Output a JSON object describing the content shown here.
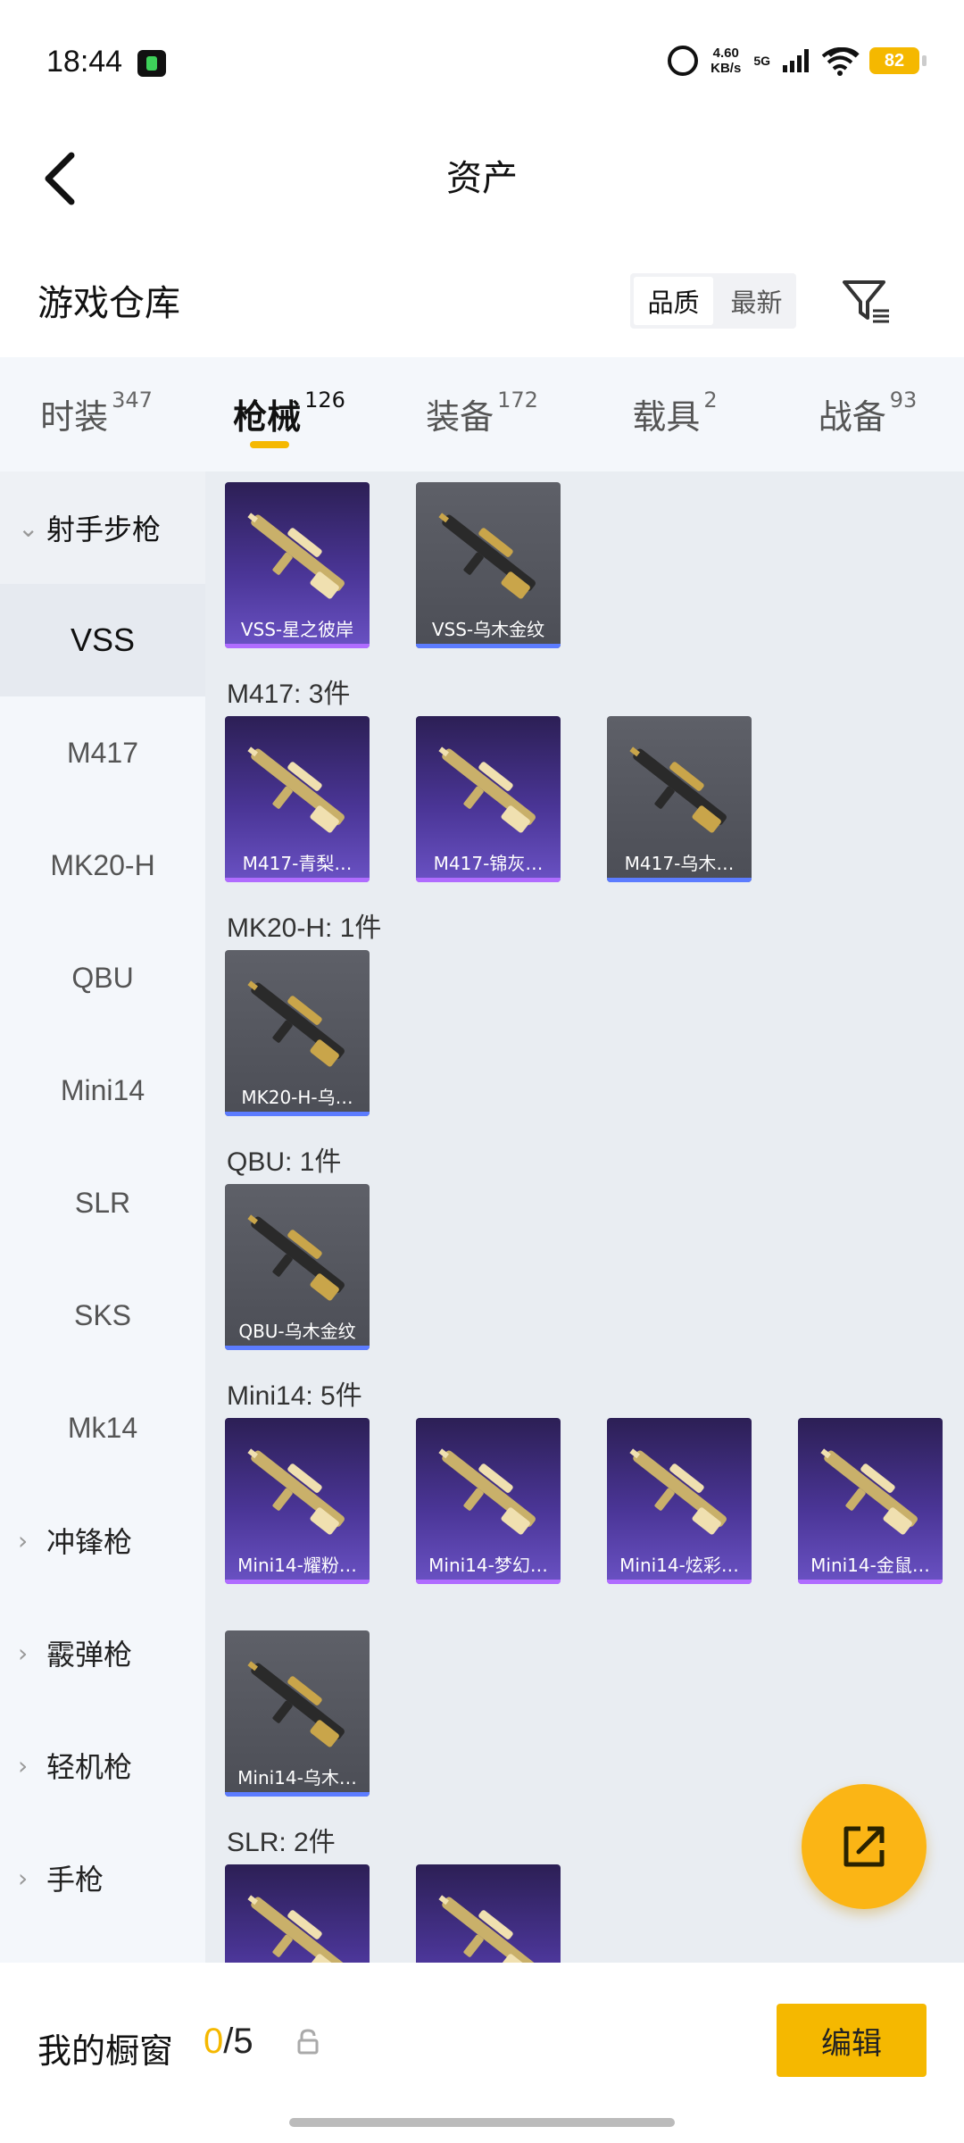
{
  "status_bar": {
    "time": "18:44",
    "net_speed_value": "4.60",
    "net_speed_unit": "KB/s",
    "network_type": "5G",
    "battery": "82"
  },
  "header": {
    "title": "资产"
  },
  "section": {
    "title": "游戏仓库",
    "sort_options": [
      "品质",
      "最新"
    ],
    "active_sort": "品质"
  },
  "tabs": [
    {
      "label": "时装",
      "count": "347"
    },
    {
      "label": "枪械",
      "count": "126",
      "active": true
    },
    {
      "label": "装备",
      "count": "172"
    },
    {
      "label": "载具",
      "count": "2"
    },
    {
      "label": "战备",
      "count": "93"
    }
  ],
  "sidebar": [
    {
      "label": "射手步枪",
      "type": "group",
      "expanded": true
    },
    {
      "label": "VSS",
      "type": "sub",
      "selected": true
    },
    {
      "label": "M417",
      "type": "sub"
    },
    {
      "label": "MK20-H",
      "type": "sub"
    },
    {
      "label": "QBU",
      "type": "sub"
    },
    {
      "label": "Mini14",
      "type": "sub"
    },
    {
      "label": "SLR",
      "type": "sub"
    },
    {
      "label": "SKS",
      "type": "sub"
    },
    {
      "label": "Mk14",
      "type": "sub"
    },
    {
      "label": "冲锋枪",
      "type": "group"
    },
    {
      "label": "霰弹枪",
      "type": "group"
    },
    {
      "label": "轻机枪",
      "type": "group"
    },
    {
      "label": "手枪",
      "type": "group"
    }
  ],
  "groups": [
    {
      "label": "",
      "items": [
        {
          "name": "VSS-星之彼岸",
          "tier": "purple"
        },
        {
          "name": "VSS-乌木金纹",
          "tier": "gray"
        }
      ]
    },
    {
      "label": "M417: 3件",
      "items": [
        {
          "name": "M417-青梨…",
          "tier": "purple"
        },
        {
          "name": "M417-锦灰…",
          "tier": "purple"
        },
        {
          "name": "M417-乌木…",
          "tier": "gray"
        }
      ]
    },
    {
      "label": "MK20-H: 1件",
      "items": [
        {
          "name": "MK20-H-乌…",
          "tier": "gray"
        }
      ]
    },
    {
      "label": "QBU: 1件",
      "items": [
        {
          "name": "QBU-乌木金纹",
          "tier": "gray"
        }
      ]
    },
    {
      "label": "Mini14: 5件",
      "items": [
        {
          "name": "Mini14-耀粉…",
          "tier": "purple"
        },
        {
          "name": "Mini14-梦幻…",
          "tier": "purple"
        },
        {
          "name": "Mini14-炫彩…",
          "tier": "purple"
        },
        {
          "name": "Mini14-金鼠…",
          "tier": "purple"
        },
        {
          "name": "Mini14-乌木…",
          "tier": "gray"
        }
      ]
    },
    {
      "label": "SLR: 2件",
      "items": [
        {
          "name": "",
          "tier": "purple"
        },
        {
          "name": "",
          "tier": "purple"
        }
      ]
    }
  ],
  "bottom_bar": {
    "label": "我的橱窗",
    "current": "0",
    "separator": "/",
    "max": "5",
    "edit_label": "编辑"
  },
  "colors": {
    "accent": "#f5b800",
    "purple_tier": "#6a52c4",
    "gray_tier": "#55575f"
  },
  "icons": {
    "back": "chevron-left-icon",
    "filter": "filter-icon",
    "fab": "share-export-icon",
    "lock": "lock-icon",
    "alarm": "alarm-icon",
    "wifi": "wifi-icon"
  }
}
